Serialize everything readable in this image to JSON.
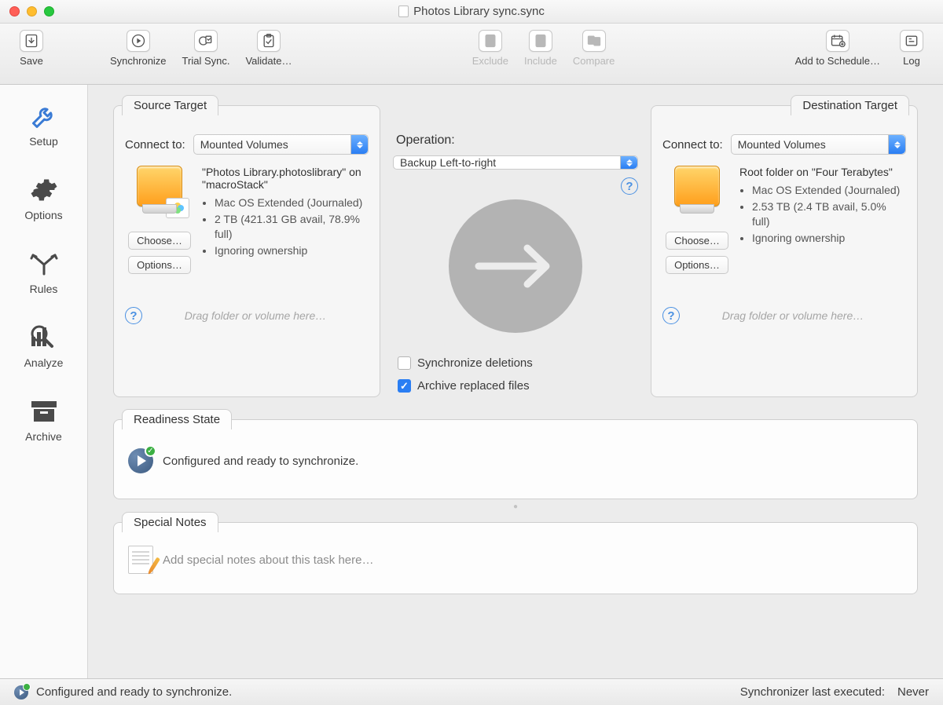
{
  "window": {
    "title": "Photos Library sync.sync"
  },
  "toolbar": {
    "save": "Save",
    "synchronize": "Synchronize",
    "trial": "Trial Sync.",
    "validate": "Validate…",
    "exclude": "Exclude",
    "include": "Include",
    "compare": "Compare",
    "schedule": "Add to Schedule…",
    "log": "Log"
  },
  "sidebar": {
    "setup": "Setup",
    "options": "Options",
    "rules": "Rules",
    "analyze": "Analyze",
    "archive": "Archive"
  },
  "source": {
    "tab": "Source Target",
    "connect_label": "Connect to:",
    "connect_value": "Mounted Volumes",
    "name": "\"Photos Library.photoslibrary\" on \"macroStack\"",
    "stat1": "Mac OS Extended (Journaled)",
    "stat2": "2 TB (421.31 GB avail, 78.9% full)",
    "stat3": "Ignoring ownership",
    "choose": "Choose…",
    "options": "Options…",
    "drag": "Drag folder or volume here…"
  },
  "destination": {
    "tab": "Destination Target",
    "connect_label": "Connect to:",
    "connect_value": "Mounted Volumes",
    "name": "Root folder on \"Four Terabytes\"",
    "stat1": "Mac OS Extended (Journaled)",
    "stat2": "2.53 TB (2.4 TB avail, 5.0% full)",
    "stat3": "Ignoring ownership",
    "choose": "Choose…",
    "options": "Options…",
    "drag": "Drag folder or volume here…"
  },
  "operation": {
    "label": "Operation:",
    "value": "Backup Left-to-right",
    "sync_deletions": "Synchronize deletions",
    "archive_replaced": "Archive replaced files"
  },
  "readiness": {
    "tab": "Readiness State",
    "text": "Configured and ready to synchronize."
  },
  "notes": {
    "tab": "Special Notes",
    "placeholder": "Add special notes about this task here…"
  },
  "status": {
    "text": "Configured and ready to synchronize.",
    "right_label": "Synchronizer last executed:",
    "right_value": "Never"
  }
}
